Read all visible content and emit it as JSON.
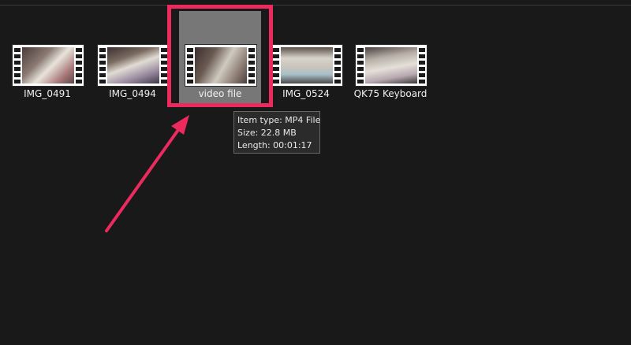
{
  "files": [
    {
      "label": "IMG_0491"
    },
    {
      "label": "IMG_0494"
    },
    {
      "label": "video file",
      "selected": true
    },
    {
      "label": "IMG_0524"
    },
    {
      "label": "QK75 Keyboard"
    }
  ],
  "tooltip": {
    "item_type": "Item type: MP4 File",
    "size": "Size: 22.8 MB",
    "length": "Length: 00:01:17"
  },
  "colors": {
    "highlight": "#ec2a5e",
    "selection": "#777777",
    "background": "#191919"
  }
}
